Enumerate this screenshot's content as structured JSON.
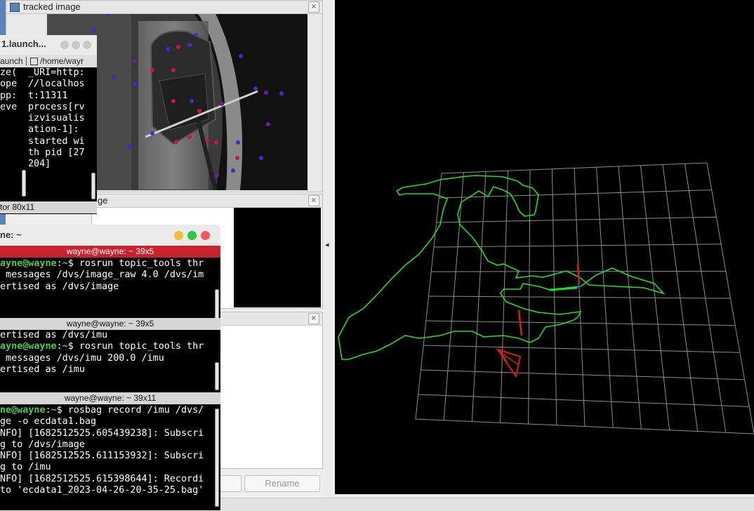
{
  "rviz": {
    "tracked_title": "tracked image",
    "second_panel_title_fragment": "ge",
    "rename_label": "Rename",
    "close_symbol": "×",
    "collapse_arrow": "◂",
    "dot_colors": {
      "blue": "#3a2bd6",
      "red": "#d01246",
      "purple": "#6a1ca8"
    },
    "grid_color": "#8c8c8c",
    "path_color": "#22dd22",
    "pose_color": "#e01818"
  },
  "launch_term": {
    "title": "1.launch...",
    "tab_left": "aunch",
    "tab_right": "/home/wayr",
    "left_fragments": [
      "",
      "",
      "",
      "",
      "ze(",
      "ope",
      "",
      "",
      "pp:",
      "eve"
    ],
    "right_lines": [
      "_URI=http:",
      "//localhos",
      "t:11311",
      "",
      "process[rv",
      "izvisualis",
      "ation-1]:",
      "started wi",
      "th pid [27",
      "204]"
    ],
    "footer": "tor 80x11"
  },
  "main_term": {
    "title": "ne: ~",
    "traffic_colors": [
      "#f4bf2f",
      "#29c940",
      "#fc5753"
    ],
    "pane1": {
      "bar": "wayne@wayne: ~ 39x5",
      "lines": [
        {
          "user": "ayne@wayne",
          "sep": ":",
          "path": "~",
          "cmd": "$ rosrun topic_tools thr"
        },
        {
          "text": " messages /dvs/image_raw 4.0 /dvs/im"
        },
        {
          "text": ""
        },
        {
          "text": "ertised as /dvs/image"
        }
      ]
    },
    "pane2": {
      "bar": "wayne@wayne: ~ 39x5",
      "lines": [
        {
          "text": "ertised as /dvs/imu"
        },
        {
          "user": "ayne@wayne",
          "sep": ":",
          "path": "~",
          "cmd": "$ rosrun topic_tools thr"
        },
        {
          "text": " messages /dvs/imu 200.0 /imu"
        },
        {
          "text": "ertised as /imu"
        }
      ]
    },
    "pane3": {
      "bar": "wayne@wayne: ~ 39x11",
      "lines": [
        {
          "user": "ne@wayne",
          "sep": ":",
          "path": "~",
          "cmd": "$ rosbag record /imu /dvs/"
        },
        {
          "text": "ge -o ecdata1.bag"
        },
        {
          "text": "NFO] [1682512525.605439238]: Subscri"
        },
        {
          "text": "g to /dvs/image"
        },
        {
          "text": "NFO] [1682512525.611153932]: Subscri"
        },
        {
          "text": "g to /imu"
        },
        {
          "text": "NFO] [1682512525.615398644]: Recordi"
        },
        {
          "text": "to 'ecdata1_2023-04-26-20-35-25.bag'"
        }
      ]
    }
  }
}
